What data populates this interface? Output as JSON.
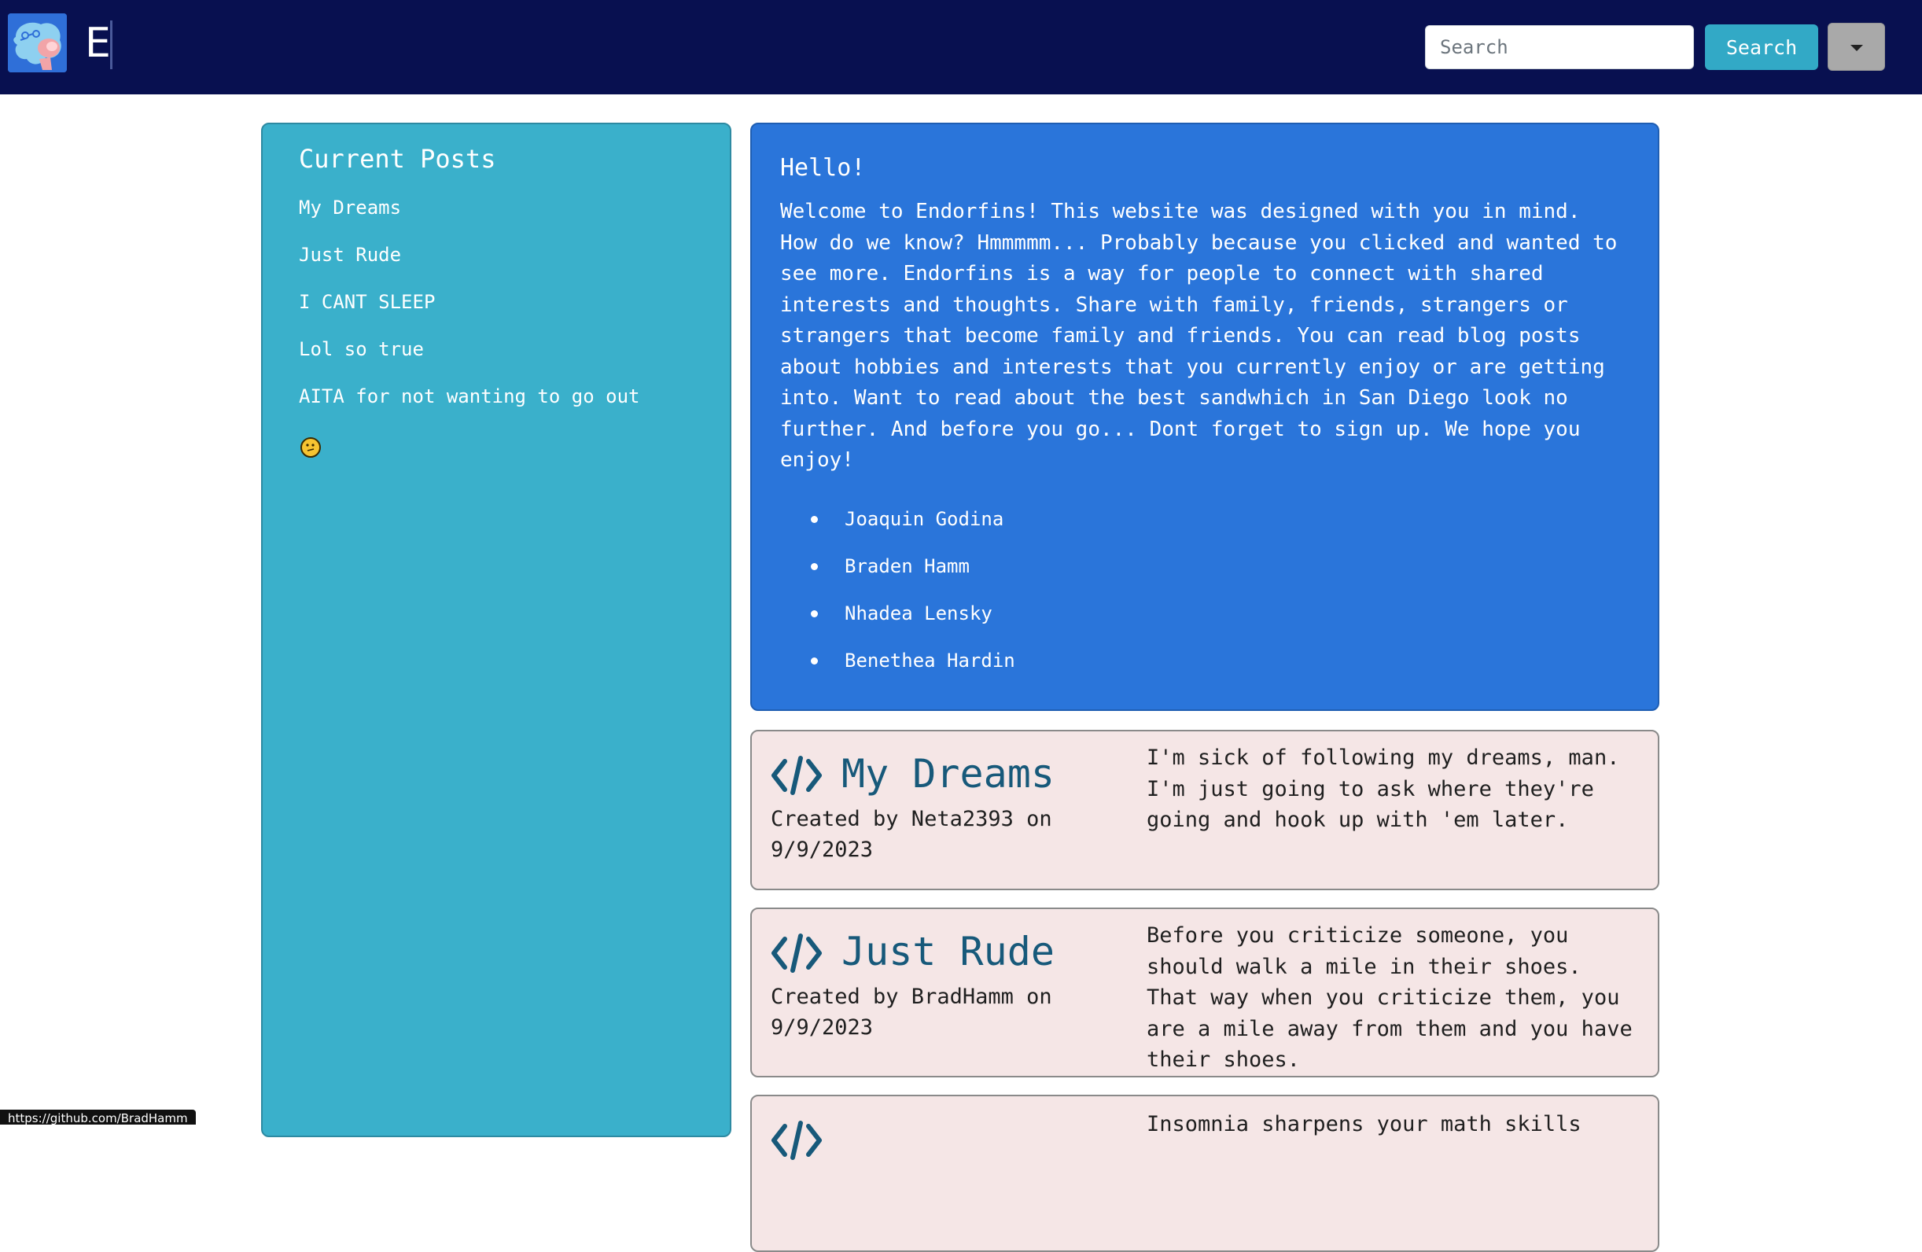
{
  "navbar": {
    "brand": "E",
    "search": {
      "placeholder": "Search",
      "button_label": "Search"
    },
    "colors": {
      "background": "#081050",
      "search_button": "#32a9c6",
      "dropdown": "#a9a9a9"
    }
  },
  "sidebar": {
    "title": "Current Posts",
    "items": [
      {
        "label": "My Dreams"
      },
      {
        "label": "Just Rude"
      },
      {
        "label": "I CANT SLEEP"
      },
      {
        "label": "Lol so true"
      },
      {
        "label": "AITA for not wanting to go out"
      }
    ],
    "emoji": "thinking-face-icon",
    "color": "#3ab0cb"
  },
  "hello": {
    "title": "Hello!",
    "text": "Welcome to Endorfins! This website was designed with you in mind.\nHow do we know? Hmmmmm... Probably because you clicked and wanted to\nsee more. Endorfins is a way for people to connect with shared\ninterests and thoughts. Share with family, friends, strangers or\nstrangers that become family and friends. You can read blog posts\nabout hobbies and interests that you currently enjoy or are getting\ninto. Want to read about the best sandwhich in San Diego look no\nfurther. And before you go... Dont forget to sign up. We hope you\nenjoy!",
    "authors": [
      "Joaquin Godina",
      "Braden Hamm",
      "Nhadea Lensky",
      "Benethea Hardin"
    ],
    "color": "#2a75da"
  },
  "posts": [
    {
      "title": "My Dreams",
      "meta": "Created by Neta2393 on 9/9/2023",
      "body": "I'm sick of following my dreams, man. I'm just going to ask where they're going and hook up with 'em later."
    },
    {
      "title": "Just Rude",
      "meta": "Created by BradHamm on 9/9/2023",
      "body": "Before you criticize someone, you should walk a mile in their shoes. That way when you criticize them, you are a mile away from them and you have their shoes."
    },
    {
      "title": "",
      "meta": "",
      "body": "Insomnia sharpens your math skills"
    }
  ],
  "status_bar": {
    "url": "https://github.com/BradHamm"
  }
}
